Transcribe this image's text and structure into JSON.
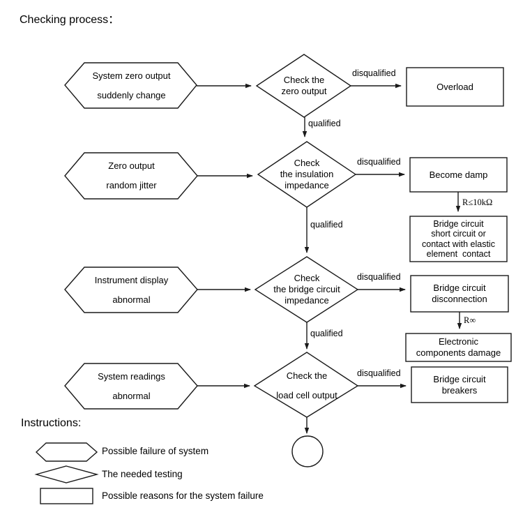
{
  "page": {
    "title": "Checking process：",
    "instructions_heading": "Instructions:"
  },
  "rows": [
    {
      "symptom": {
        "line1": "System zero output",
        "line2": "suddenly change"
      },
      "decision": {
        "line1": "Check the",
        "line2": "zero output",
        "line3": ""
      },
      "disqualified_label": "disqualified",
      "qualified_label": "qualified",
      "result": {
        "lines": "Overload"
      }
    },
    {
      "symptom": {
        "line1": "Zero output",
        "line2": "random jitter"
      },
      "decision": {
        "line1": "Check",
        "line2": "the insulation",
        "line3": "impedance"
      },
      "disqualified_label": "disqualified",
      "qualified_label": "qualified",
      "result": {
        "lines": "Become damp"
      },
      "condition_label": "R≤10kΩ",
      "sub_result": {
        "lines": "Bridge circuit\nshort circuit or\ncontact with elastic\nelement  contact"
      }
    },
    {
      "symptom": {
        "line1": "Instrument display",
        "line2": "abnormal"
      },
      "decision": {
        "line1": "Check",
        "line2": "the bridge circuit",
        "line3": "impedance"
      },
      "disqualified_label": "disqualified",
      "qualified_label": "qualified",
      "result": {
        "lines": "Bridge circuit\ndisconnection"
      },
      "condition_label": "R∞",
      "sub_result": {
        "lines": "Electronic\ncomponents damage"
      }
    },
    {
      "symptom": {
        "line1": "System readings",
        "line2": "abnormal"
      },
      "decision": {
        "line1": "Check the",
        "line2": "load cell output",
        "line3": ""
      },
      "disqualified_label": "disqualified",
      "result": {
        "lines": "Bridge circuit\nbreakers"
      }
    }
  ],
  "legend": [
    {
      "shape": "hexagon",
      "text": "Possible failure of system"
    },
    {
      "shape": "diamond",
      "text": "The needed testing"
    },
    {
      "shape": "rectangle",
      "text": "Possible reasons for the system failure"
    }
  ],
  "colors": {
    "stroke": "#1a1a1a",
    "fill": "#ffffff",
    "text": "#000000"
  }
}
